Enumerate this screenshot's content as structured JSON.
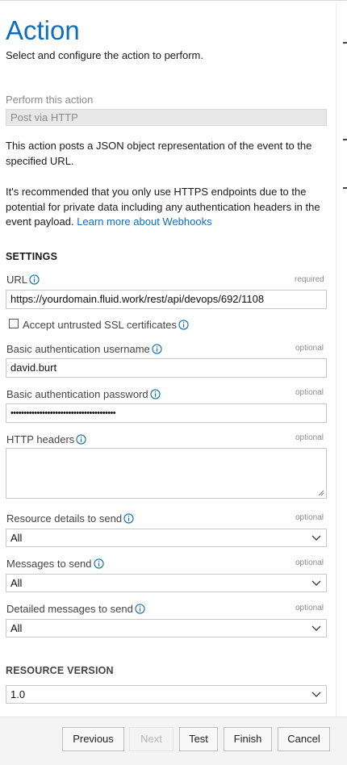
{
  "header": {
    "title": "Action",
    "subtitle": "Select and configure the action to perform."
  },
  "action": {
    "label": "Perform this action",
    "value": "Post via HTTP"
  },
  "description": {
    "para1": "This action posts a JSON object representation of the event to the specified URL.",
    "para2_text": "It's recommended that you only use HTTPS endpoints due to the potential for private data including any authentication headers in the event payload. ",
    "para2_link": "Learn more about Webhooks"
  },
  "settings": {
    "heading": "SETTINGS",
    "url": {
      "label": "URL",
      "hint": "required",
      "value": "https://yourdomain.fluid.work/rest/api/devops/692/1108"
    },
    "ssl": {
      "label": "Accept untrusted SSL certificates",
      "checked": false
    },
    "username": {
      "label": "Basic authentication username",
      "hint": "optional",
      "value": "david.burt"
    },
    "password": {
      "label": "Basic authentication password",
      "hint": "optional",
      "value": "••••••••••••••••••••••••••••••••••••••••"
    },
    "headers": {
      "label": "HTTP headers",
      "hint": "optional",
      "value": ""
    },
    "resource_details": {
      "label": "Resource details to send",
      "hint": "optional",
      "value": "All"
    },
    "messages": {
      "label": "Messages to send",
      "hint": "optional",
      "value": "All"
    },
    "detailed_messages": {
      "label": "Detailed messages to send",
      "hint": "optional",
      "value": "All"
    }
  },
  "resource_version": {
    "heading": "RESOURCE VERSION",
    "value": "1.0"
  },
  "footer": {
    "previous": "Previous",
    "next": "Next",
    "test": "Test",
    "finish": "Finish",
    "cancel": "Cancel"
  },
  "icons": {
    "info": "info-circle-icon",
    "chevron": "chevron-down-icon",
    "resize": "resize-grip-icon"
  },
  "colors": {
    "accent": "#106ebe",
    "readonly_bg": "#e8e8e8",
    "footer_bg": "#f4f4f4"
  }
}
